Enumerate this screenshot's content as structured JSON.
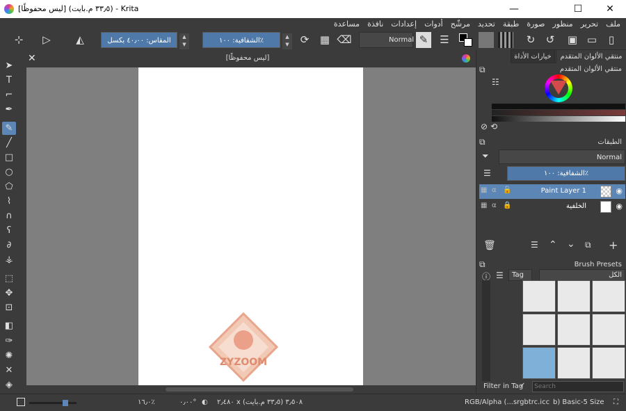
{
  "window": {
    "title": "[ليس محفوظًا] (٣٣٫٥ م.بايت) - Krita",
    "min": "—",
    "max": "☐",
    "close": "✕"
  },
  "menu": [
    "ملف",
    "تحرير",
    "منظور",
    "صورة",
    "طبقة",
    "تحديد",
    "مرشّح",
    "أدوات",
    "إعدادات",
    "نافذة",
    "مساعدة"
  ],
  "toolbar": {
    "blend_mode": "Normal",
    "opacity_label": "الشفافية: ١٠٠٪",
    "size_label": "المقاس: ٤٠٫٠٠ بكسل"
  },
  "document": {
    "title": "[ليس محفوظًا]",
    "watermark": "ZYZOOM"
  },
  "dock": {
    "tab_advanced_color": "منتقي الألوان المتقدم",
    "tab_tool_options": "خيارات الأداة",
    "advanced_color_title": "منتقي الألوان المتقدم",
    "layers_title": "الطبقات",
    "layer_blend": "Normal",
    "layer_opacity": "الشفافية: ١٠٠٪",
    "layers": [
      {
        "name": "Paint Layer 1",
        "selected": true
      },
      {
        "name": "الخلفية",
        "selected": false
      }
    ],
    "brush_presets_title": "Brush Presets",
    "preset_filter_all": "الكل",
    "preset_tag": "Tag",
    "filter_in_tag_label": "Filter in Tag",
    "search_placeholder": "Search"
  },
  "status": {
    "zoom": "١٦٫٠٪",
    "rotation": "٠٫٠٠°",
    "image_info": "٢٫٤٨٠ x ٣٫٥٠٨ (٣٣٫٥ م.بايت)",
    "color_space": "RGB/Alpha (...srgbtrc.icc",
    "brush": "b) Basic-5 Size"
  },
  "colors": {
    "accent": "#5b86b6",
    "field_blue": "#4f79a8",
    "bg": "#3b3b3b",
    "canvas_gray": "#7f7f7f"
  }
}
